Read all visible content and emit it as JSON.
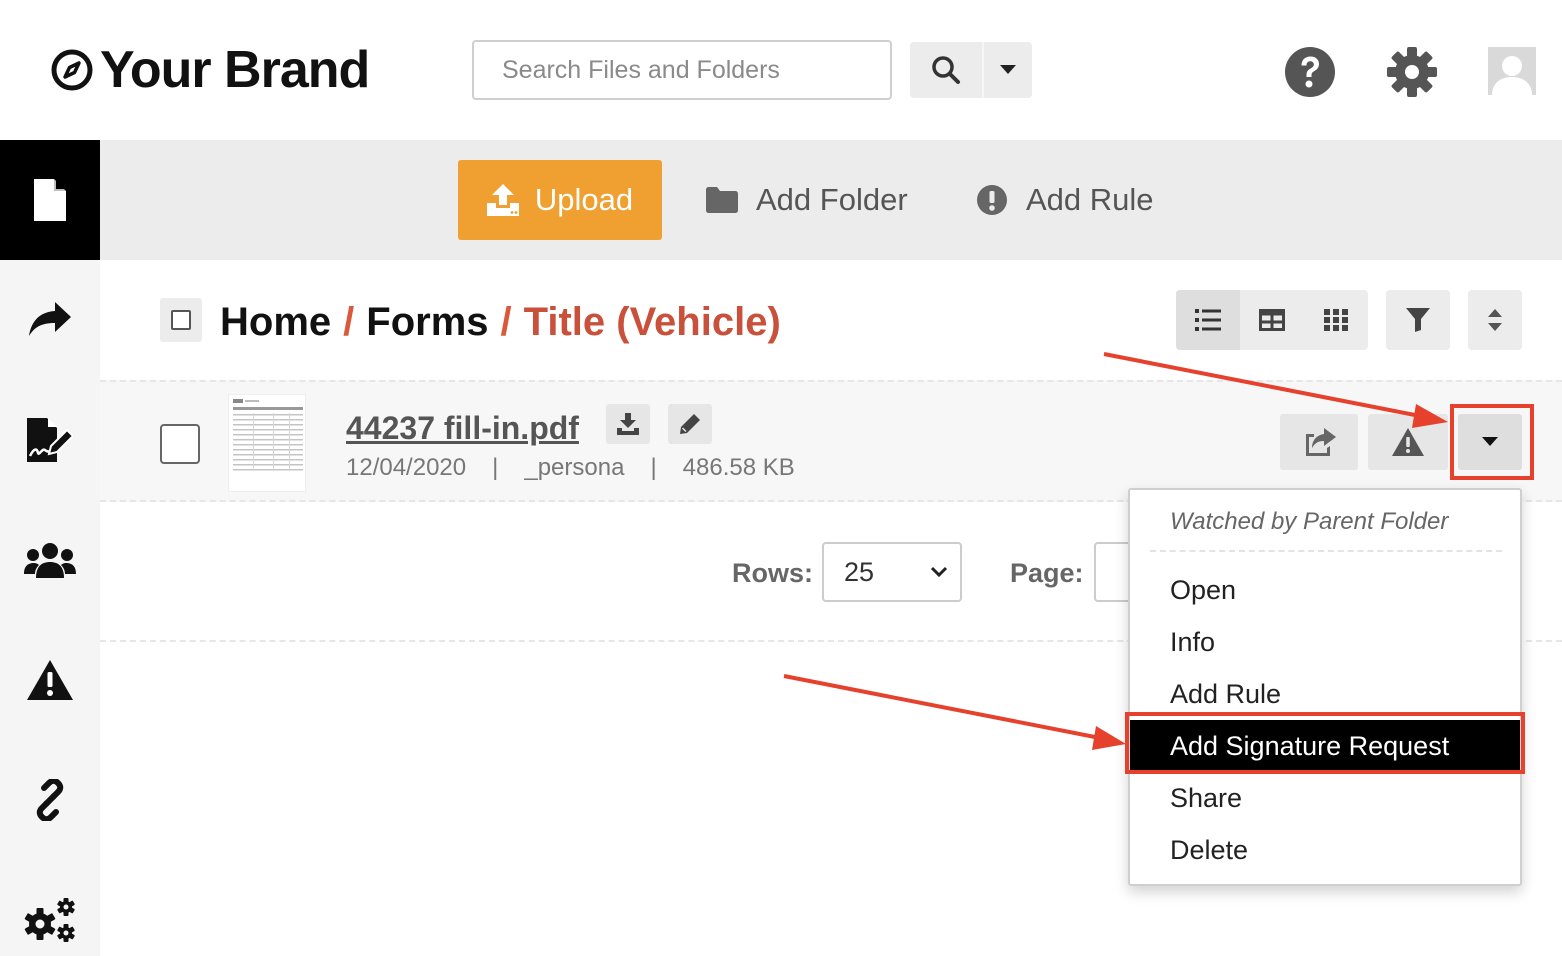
{
  "header": {
    "brand": "Your Brand",
    "search_placeholder": "Search Files and Folders"
  },
  "toolbar": {
    "upload_label": "Upload",
    "add_folder_label": "Add Folder",
    "add_rule_label": "Add Rule"
  },
  "breadcrumb": {
    "items": [
      "Home",
      "Forms"
    ],
    "separator": "/",
    "current": "Title (Vehicle)"
  },
  "file": {
    "name": "44237 fill-in.pdf",
    "date": "12/04/2020",
    "owner": "_persona",
    "size": "486.58 KB",
    "meta_separator": "|"
  },
  "pager": {
    "rows_label": "Rows:",
    "rows_value": "25",
    "page_label": "Page:"
  },
  "menu": {
    "header": "Watched by Parent Folder",
    "items": [
      "Open",
      "Info",
      "Add Rule",
      "Add Signature Request",
      "Share",
      "Delete"
    ],
    "selected": "Add Signature Request"
  },
  "colors": {
    "accent": "#f0a030",
    "breadcrumb_current": "#c9503a",
    "annotation": "#e5412d",
    "sidebar_active": "#000000"
  }
}
